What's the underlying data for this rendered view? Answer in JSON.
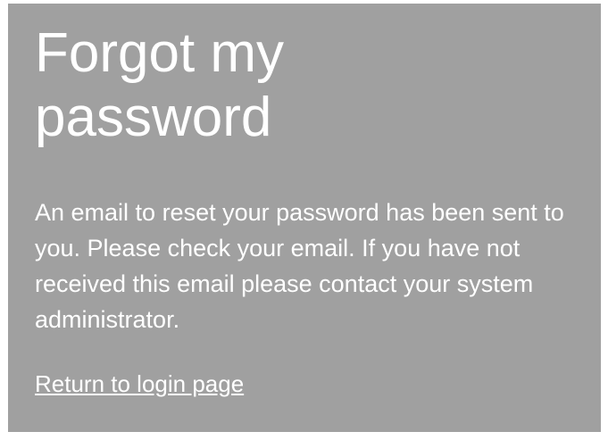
{
  "page": {
    "title": "Forgot my password",
    "message": "An email to reset your password has been sent to you. Please check your email. If you have not received this email please contact your system administrator.",
    "return_link_label": "Return to login page"
  },
  "colors": {
    "panel_background": "#a0a0a0",
    "text": "#ffffff"
  }
}
